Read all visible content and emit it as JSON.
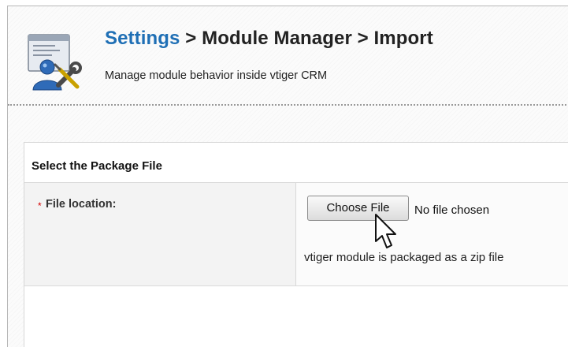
{
  "header": {
    "breadcrumb_settings": "Settings",
    "breadcrumb_rest": " > Module Manager > Import",
    "subtitle": "Manage module behavior inside vtiger CRM",
    "icon": "settings-tools-icon"
  },
  "panel": {
    "heading": "Select the Package File",
    "field": {
      "required_marker": "*",
      "label": "File location:",
      "button_label": "Choose File",
      "file_status": "No file chosen",
      "help_text": "vtiger module is packaged as a zip file"
    }
  },
  "cursor": {
    "icon": "mouse-pointer-icon"
  },
  "colors": {
    "link": "#1f6fb5",
    "required": "#d40000",
    "label_bg": "#f3f3f3"
  }
}
